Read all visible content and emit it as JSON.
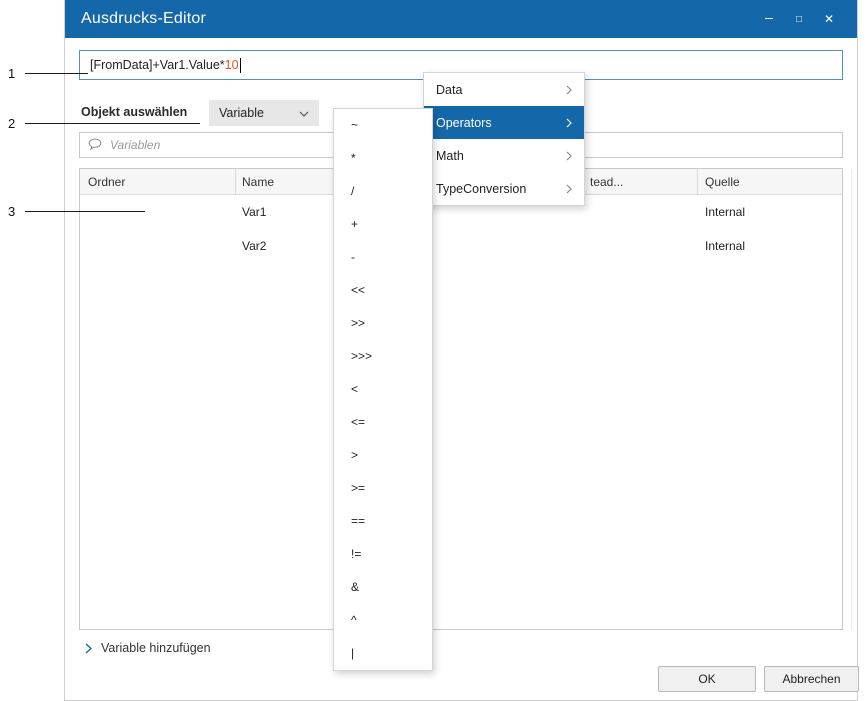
{
  "window": {
    "title": "Ausdrucks-Editor",
    "controls": {
      "minimize": "–",
      "maximize": "□",
      "close": "✕"
    }
  },
  "annotations": {
    "a1": "1",
    "a2": "2",
    "a3": "3"
  },
  "expression": {
    "code": "[FromData]+Var1.Value*",
    "number": "10"
  },
  "object_select": {
    "label": "Objekt auswählen",
    "value": "Variable"
  },
  "search": {
    "placeholder": "Variablen"
  },
  "table": {
    "headers": {
      "ordner": "Ordner",
      "name": "Name",
      "truncated": "tead...",
      "quelle": "Quelle"
    },
    "rows": [
      {
        "name": "Var1",
        "quelle": "Internal"
      },
      {
        "name": "Var2",
        "quelle": "Internal"
      }
    ]
  },
  "context_menu": {
    "items": [
      {
        "label": "Data"
      },
      {
        "label": "Operators"
      },
      {
        "label": "Math"
      },
      {
        "label": "TypeConversion"
      }
    ]
  },
  "operators_submenu": {
    "items": [
      "~",
      "*",
      "/",
      "+",
      "-",
      "<<",
      ">>",
      ">>>",
      "<",
      "<=",
      ">",
      ">=",
      "==",
      "!=",
      "&",
      "^",
      "|"
    ]
  },
  "footer": {
    "add_variable": "Variable hinzufügen",
    "ok": "OK",
    "cancel": "Abbrechen"
  },
  "colors": {
    "titlebar": "#1467a8",
    "selection": "#1467a8",
    "input_border": "#4f8fcc",
    "number_literal": "#e0562a"
  }
}
